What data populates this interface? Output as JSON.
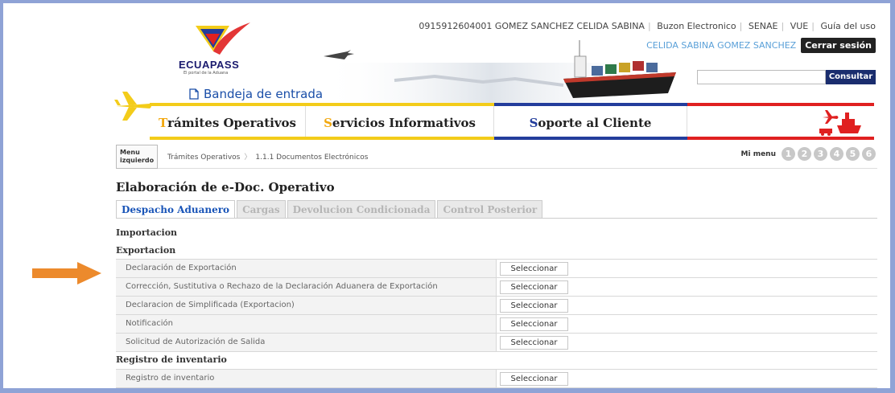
{
  "brand": {
    "name": "ECUAPASS",
    "tagline": "El portal de la Aduana"
  },
  "inbox_label": "Bandeja de entrada",
  "top_links": {
    "user_id": "0915912604001 GOMEZ SANCHEZ CELIDA SABINA",
    "buzon": "Buzon Electronico",
    "senae": "SENAE",
    "vue": "VUE",
    "guia": "Guía del uso"
  },
  "user_name": "CELIDA SABINA GOMEZ SANCHEZ",
  "logout_label": "Cerrar sesión",
  "search": {
    "value": "",
    "button": "Consultar"
  },
  "nav": [
    {
      "first": "T",
      "rest": "rámites Operativos"
    },
    {
      "first": "S",
      "rest": "ervicios Informativos"
    },
    {
      "first": "S",
      "rest": "oporte al Cliente"
    }
  ],
  "menu_tab": {
    "line1": "Menu",
    "line2": "izquierdo"
  },
  "breadcrumb": [
    "Trámites Operativos",
    "1.1.1 Documentos Electrónicos"
  ],
  "mi_menu": {
    "label": "Mi menu",
    "items": [
      "1",
      "2",
      "3",
      "4",
      "5",
      "6"
    ]
  },
  "page_title": "Elaboración de e-Doc. Operativo",
  "tabs": [
    {
      "label": "Despacho Aduanero",
      "active": true
    },
    {
      "label": "Cargas",
      "active": false
    },
    {
      "label": "Devolucion Condicionada",
      "active": false
    },
    {
      "label": "Control Posterior",
      "active": false
    }
  ],
  "sections": {
    "importacion": "Importacion",
    "exportacion": "Exportacion",
    "registro": "Registro de inventario"
  },
  "export_rows": [
    {
      "label": "Declaración de Exportación",
      "button": "Seleccionar"
    },
    {
      "label": "Corrección, Sustitutiva o Rechazo de la Declaración Aduanera de Exportación",
      "button": "Seleccionar"
    },
    {
      "label": "Declaracion de Simplificada (Exportacion)",
      "button": "Seleccionar"
    },
    {
      "label": "Notificación",
      "button": "Seleccionar"
    },
    {
      "label": "Solicitud de Autorización de Salida",
      "button": "Seleccionar"
    }
  ],
  "registro_rows": [
    {
      "label": "Registro de inventario",
      "button": "Seleccionar"
    }
  ],
  "colors": {
    "yellow": "#f3cc1a",
    "blue": "#233d9c",
    "red": "#e02020",
    "accent_orange": "#ec8a2c",
    "link_blue": "#1a55b8"
  }
}
